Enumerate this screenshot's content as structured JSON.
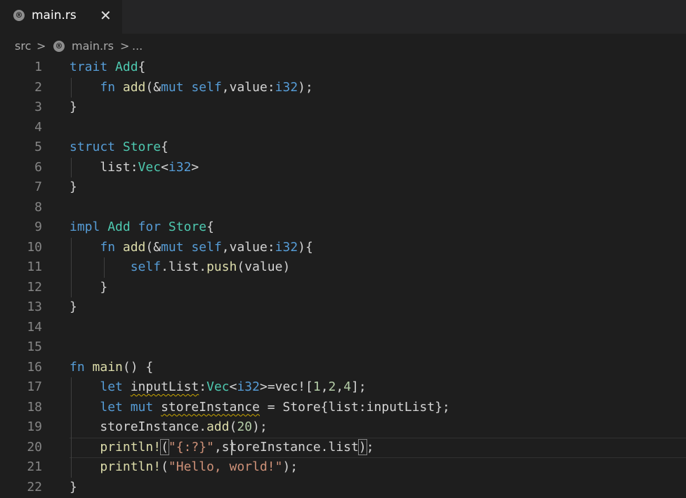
{
  "tab": {
    "label": "main.rs",
    "close_glyph": "✕",
    "icon": "rust-file-icon"
  },
  "breadcrumb": {
    "folder": "src",
    "file": "main.rs",
    "rest": "...",
    "separator": ">"
  },
  "colors": {
    "keyword": "#569cd6",
    "type": "#4ec9b0",
    "function": "#dcdcaa",
    "string": "#ce9178",
    "number": "#b5cea8",
    "text": "#d4d4d4",
    "warning_squiggle": "#cca700"
  },
  "editor": {
    "active_line": 20,
    "lines": [
      [
        [
          "kw",
          "trait "
        ],
        [
          "ty",
          "Add"
        ],
        [
          "pn",
          "{"
        ]
      ],
      [
        [
          "pn",
          "    "
        ],
        [
          "kw",
          "fn "
        ],
        [
          "fn",
          "add"
        ],
        [
          "pn",
          "(&"
        ],
        [
          "kw",
          "mut "
        ],
        [
          "kw",
          "self"
        ],
        [
          "pn",
          ",value:"
        ],
        [
          "kw",
          "i32"
        ],
        [
          "pn",
          ");"
        ]
      ],
      [
        [
          "pn",
          "}"
        ]
      ],
      [],
      [
        [
          "kw",
          "struct "
        ],
        [
          "ty",
          "Store"
        ],
        [
          "pn",
          "{"
        ]
      ],
      [
        [
          "pn",
          "    list:"
        ],
        [
          "ty",
          "Vec"
        ],
        [
          "pn",
          "<"
        ],
        [
          "kw",
          "i32"
        ],
        [
          "pn",
          ">"
        ]
      ],
      [
        [
          "pn",
          "}"
        ]
      ],
      [],
      [
        [
          "kw",
          "impl "
        ],
        [
          "ty",
          "Add "
        ],
        [
          "kw",
          "for "
        ],
        [
          "ty",
          "Store"
        ],
        [
          "pn",
          "{"
        ]
      ],
      [
        [
          "pn",
          "    "
        ],
        [
          "kw",
          "fn "
        ],
        [
          "fn",
          "add"
        ],
        [
          "pn",
          "(&"
        ],
        [
          "kw",
          "mut "
        ],
        [
          "kw",
          "self"
        ],
        [
          "pn",
          ",value:"
        ],
        [
          "kw",
          "i32"
        ],
        [
          "pn",
          "){"
        ]
      ],
      [
        [
          "pn",
          "        "
        ],
        [
          "kw",
          "self"
        ],
        [
          "pn",
          ".list."
        ],
        [
          "fn",
          "push"
        ],
        [
          "pn",
          "(value)"
        ]
      ],
      [
        [
          "pn",
          "    }"
        ]
      ],
      [
        [
          "pn",
          "}"
        ]
      ],
      [],
      [],
      [
        [
          "kw",
          "fn "
        ],
        [
          "fn",
          "main"
        ],
        [
          "pn",
          "() {"
        ]
      ],
      [
        [
          "pn",
          "    "
        ],
        [
          "kw",
          "let "
        ],
        [
          "sq",
          "inputList"
        ],
        [
          "pn",
          ":"
        ],
        [
          "ty",
          "Vec"
        ],
        [
          "pn",
          "<"
        ],
        [
          "kw",
          "i32"
        ],
        [
          "pn",
          ">=vec!["
        ],
        [
          "num",
          "1"
        ],
        [
          "pn",
          ","
        ],
        [
          "num",
          "2"
        ],
        [
          "pn",
          ","
        ],
        [
          "num",
          "4"
        ],
        [
          "pn",
          "];"
        ]
      ],
      [
        [
          "pn",
          "    "
        ],
        [
          "kw",
          "let "
        ],
        [
          "kw",
          "mut "
        ],
        [
          "sq",
          "storeInstance"
        ],
        [
          "pn",
          " = Store{list:inputList};"
        ]
      ],
      [
        [
          "pn",
          "    storeInstance."
        ],
        [
          "fn",
          "add"
        ],
        [
          "pn",
          "("
        ],
        [
          "num",
          "20"
        ],
        [
          "pn",
          ");"
        ]
      ],
      [
        [
          "pn",
          "    "
        ],
        [
          "fn",
          "println!"
        ],
        [
          "bm",
          "("
        ],
        [
          "str",
          "\"{:?}\""
        ],
        [
          "pn",
          ",storeInstance.list"
        ],
        [
          "bm",
          ")"
        ],
        [
          "pn",
          ";"
        ]
      ],
      [
        [
          "pn",
          "    "
        ],
        [
          "fn",
          "println!"
        ],
        [
          "pn",
          "("
        ],
        [
          "str",
          "\"Hello, world!\""
        ],
        [
          "pn",
          ");"
        ]
      ],
      [
        [
          "pn",
          "}"
        ]
      ]
    ]
  }
}
